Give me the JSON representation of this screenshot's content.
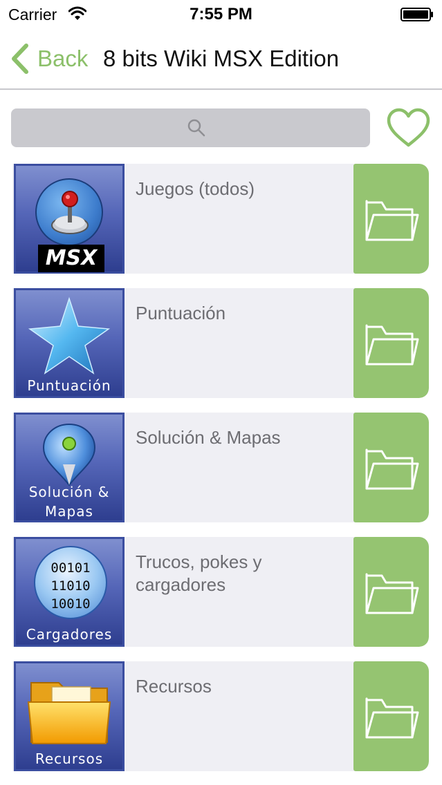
{
  "status_bar": {
    "carrier": "Carrier",
    "time": "7:55 PM"
  },
  "nav": {
    "back_label": "Back",
    "title": "8 bits Wiki MSX Edition"
  },
  "search": {
    "placeholder": ""
  },
  "colors": {
    "accent_green": "#8cc06a",
    "action_green": "#95c471",
    "row_background": "#efeff4",
    "thumb_blue": "#3b4ea0"
  },
  "list": {
    "items": [
      {
        "label": "Juegos (todos)",
        "thumb_caption": "MSX",
        "thumb_icon": "joystick-icon",
        "action_icon": "folder-icon"
      },
      {
        "label": "Puntuación",
        "thumb_caption": "Puntuación",
        "thumb_icon": "star-icon",
        "action_icon": "folder-icon"
      },
      {
        "label": "Solución & Mapas",
        "thumb_caption_lines": [
          "Solución &",
          "Mapas"
        ],
        "thumb_icon": "map-pin-icon",
        "action_icon": "folder-icon"
      },
      {
        "label_lines": [
          "Trucos, pokes y",
          "cargadores"
        ],
        "thumb_caption": "Cargadores",
        "thumb_lines": [
          "00101",
          "11010",
          "10010"
        ],
        "thumb_icon": "binary-disc-icon",
        "action_icon": "folder-icon"
      },
      {
        "label": "Recursos",
        "thumb_caption": "Recursos",
        "thumb_icon": "yellow-folder-icon",
        "action_icon": "folder-icon"
      }
    ]
  }
}
